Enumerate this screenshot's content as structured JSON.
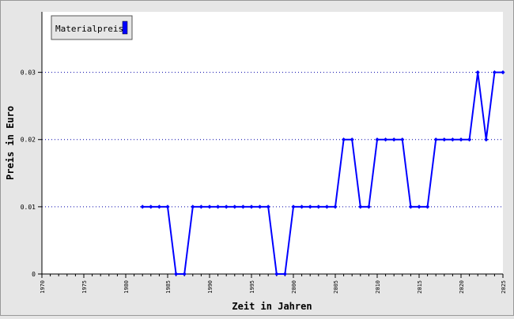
{
  "chart_data": {
    "type": "line",
    "title": "",
    "xlabel": "Zeit in Jahren",
    "ylabel": "Preis in Euro",
    "xlim": [
      1970,
      2025
    ],
    "ylim": [
      0,
      0.039
    ],
    "x_ticks": [
      "1970",
      "1975",
      "1980",
      "1985",
      "1990",
      "1995",
      "2000",
      "2005",
      "2010",
      "2015",
      "2020",
      "2025"
    ],
    "y_ticks": [
      "0",
      "0.01",
      "0.02",
      "0.03"
    ],
    "grid": "horizontal dotted",
    "legend_position": "top-left",
    "series": [
      {
        "name": "Materialpreis",
        "color": "#0000ff",
        "points": [
          {
            "x": 1982,
            "y": 0.01
          },
          {
            "x": 1983,
            "y": 0.01
          },
          {
            "x": 1984,
            "y": 0.01
          },
          {
            "x": 1985,
            "y": 0.01
          },
          {
            "x": 1986,
            "y": 0.0
          },
          {
            "x": 1987,
            "y": 0.0
          },
          {
            "x": 1988,
            "y": 0.01
          },
          {
            "x": 1989,
            "y": 0.01
          },
          {
            "x": 1990,
            "y": 0.01
          },
          {
            "x": 1991,
            "y": 0.01
          },
          {
            "x": 1992,
            "y": 0.01
          },
          {
            "x": 1993,
            "y": 0.01
          },
          {
            "x": 1994,
            "y": 0.01
          },
          {
            "x": 1995,
            "y": 0.01
          },
          {
            "x": 1996,
            "y": 0.01
          },
          {
            "x": 1997,
            "y": 0.01
          },
          {
            "x": 1998,
            "y": 0.0
          },
          {
            "x": 1999,
            "y": 0.0
          },
          {
            "x": 2000,
            "y": 0.01
          },
          {
            "x": 2001,
            "y": 0.01
          },
          {
            "x": 2002,
            "y": 0.01
          },
          {
            "x": 2003,
            "y": 0.01
          },
          {
            "x": 2004,
            "y": 0.01
          },
          {
            "x": 2005,
            "y": 0.01
          },
          {
            "x": 2006,
            "y": 0.02
          },
          {
            "x": 2007,
            "y": 0.02
          },
          {
            "x": 2008,
            "y": 0.01
          },
          {
            "x": 2009,
            "y": 0.01
          },
          {
            "x": 2010,
            "y": 0.02
          },
          {
            "x": 2011,
            "y": 0.02
          },
          {
            "x": 2012,
            "y": 0.02
          },
          {
            "x": 2013,
            "y": 0.02
          },
          {
            "x": 2014,
            "y": 0.01
          },
          {
            "x": 2015,
            "y": 0.01
          },
          {
            "x": 2016,
            "y": 0.01
          },
          {
            "x": 2017,
            "y": 0.02
          },
          {
            "x": 2018,
            "y": 0.02
          },
          {
            "x": 2019,
            "y": 0.02
          },
          {
            "x": 2020,
            "y": 0.02
          },
          {
            "x": 2021,
            "y": 0.02
          },
          {
            "x": 2022,
            "y": 0.03
          },
          {
            "x": 2023,
            "y": 0.02
          },
          {
            "x": 2024,
            "y": 0.03
          },
          {
            "x": 2025,
            "y": 0.03
          }
        ]
      }
    ]
  }
}
